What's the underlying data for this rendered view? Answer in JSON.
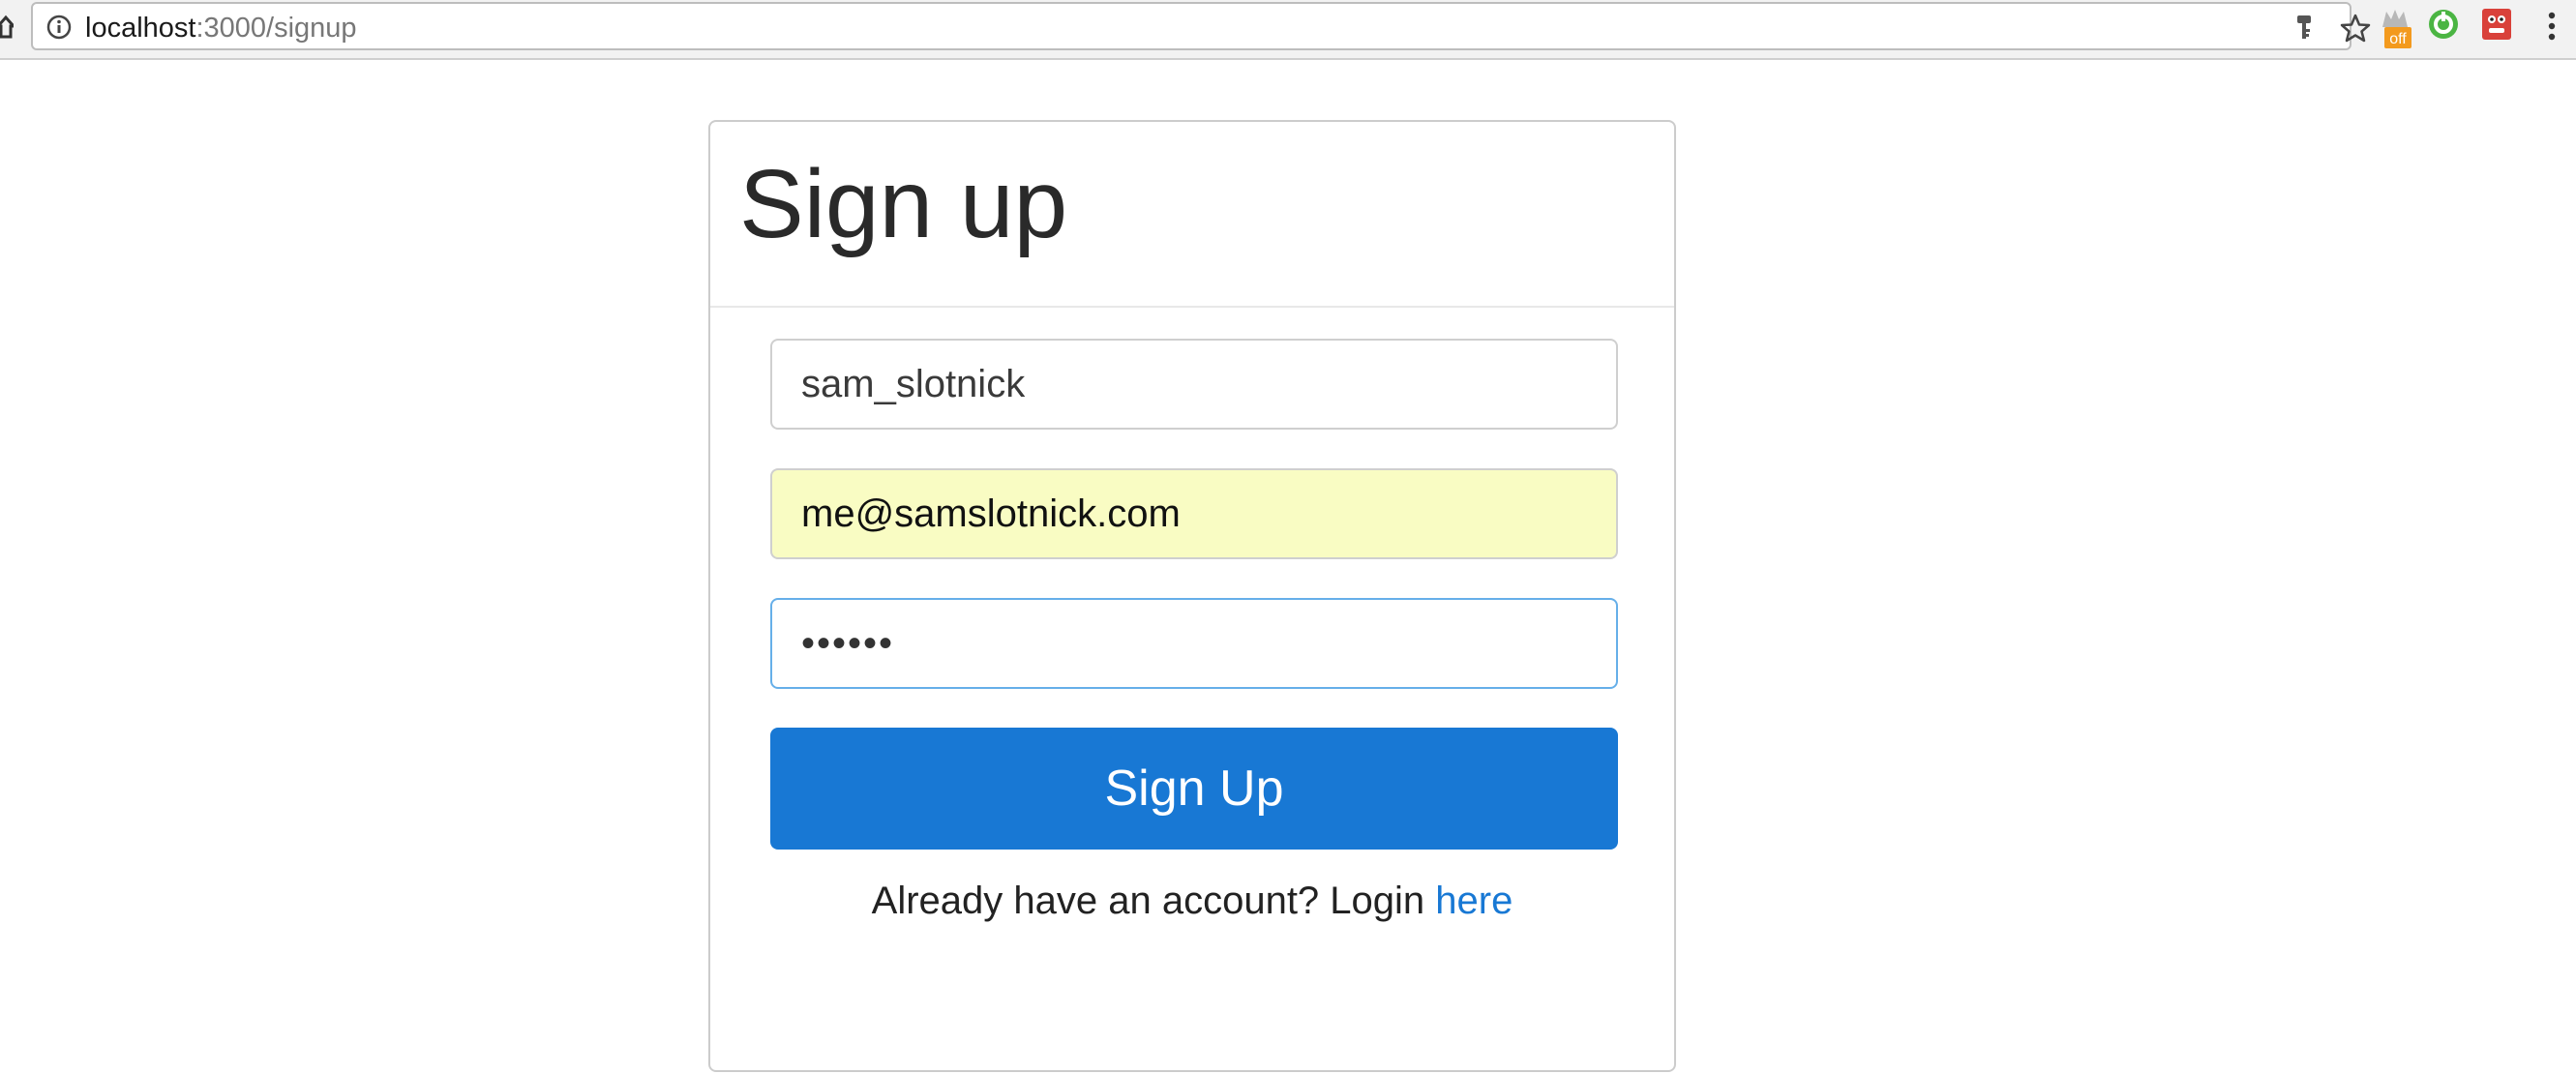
{
  "browser": {
    "url_host": "localhost",
    "url_path": ":3000/signup",
    "extension_badge": "off"
  },
  "card": {
    "title": "Sign up"
  },
  "form": {
    "username_value": "sam_slotnick",
    "email_value": "me@samslotnick.com",
    "password_value": "••••••",
    "submit_label": "Sign Up"
  },
  "footer": {
    "prompt_text": "Already have an account? Login",
    "link_text": "here"
  },
  "colors": {
    "primary": "#1878d4",
    "autofill": "#f9fcc3",
    "focus_border": "#66afe9"
  }
}
